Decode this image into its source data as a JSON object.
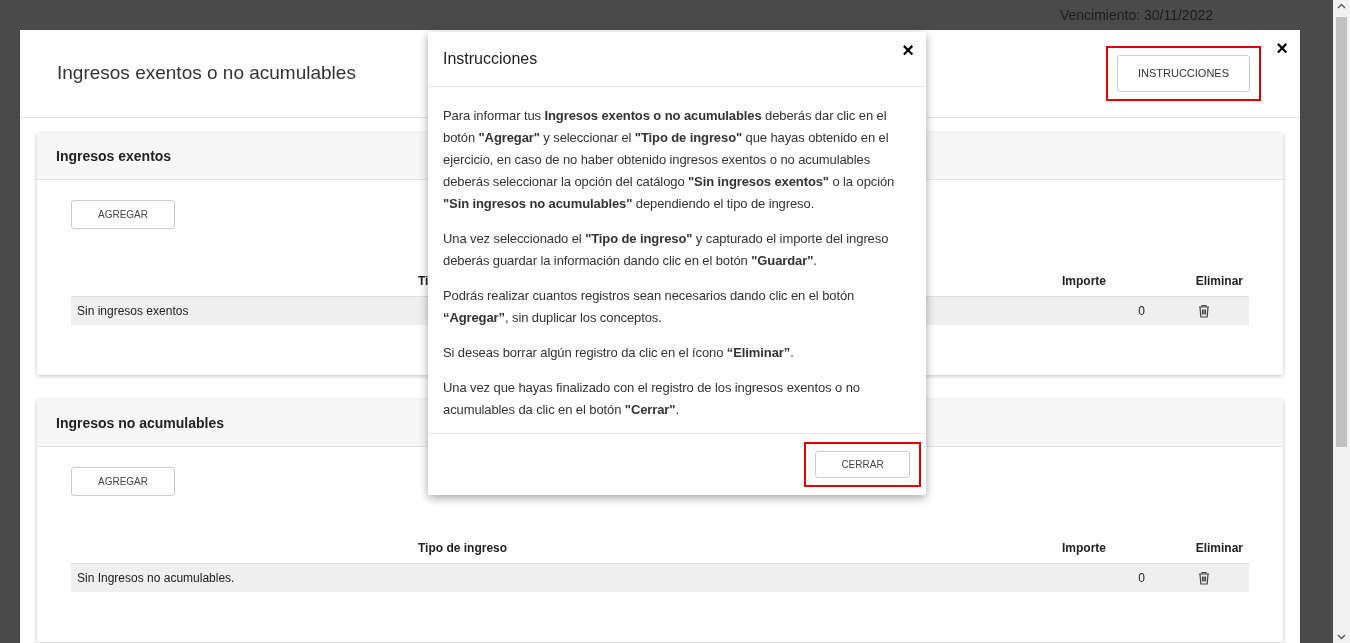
{
  "background": {
    "due_date": "Vencimiento: 30/11/2022"
  },
  "dialog": {
    "title": "Ingresos exentos o no acumulables",
    "instructions_button": {
      "label": "INSTRUCCIONES",
      "highlighted": true
    },
    "close": "×",
    "sections": [
      {
        "title": "Ingresos exentos",
        "add_button": "AGREGAR",
        "columns": [
          "Ti",
          "Importe",
          "Eliminar"
        ],
        "rows": [
          {
            "tipo": "Sin ingresos exentos",
            "importe": "0"
          }
        ]
      },
      {
        "title": "Ingresos no acumulables",
        "add_button": "AGREGAR",
        "columns": [
          "Tipo de ingreso",
          "Importe",
          "Eliminar"
        ],
        "rows": [
          {
            "tipo": "Sin Ingresos no acumulables.",
            "importe": "0"
          }
        ]
      }
    ]
  },
  "modal": {
    "title": "Instrucciones",
    "close": "×",
    "paragraphs": [
      "Para informar tus **Ingresos exentos o no acumulables** deberás dar clic en el botón **\"Agregar\"** y seleccionar el **\"Tipo de ingreso\"** que hayas obtenido en el ejercicio, en caso de no haber obtenido ingresos exentos o no acumulables deberás seleccionar la opción del catálogo **\"Sin ingresos exentos\"** o la opción **\"Sin ingresos no acumulables\"** dependiendo el tipo de ingreso.",
      "Una vez seleccionado el **\"Tipo de ingreso\"** y capturado el importe del ingreso deberás guardar la información dando clic en el botón **\"Guardar\"**.",
      "Podrás realizar cuantos registros sean necesarios dando clic en el botón **“Agregar”**, sin duplicar los conceptos.",
      "Si deseas borrar algún registro da clic en el ícono **“Eliminar”**.",
      "Una vez que hayas finalizado con el registro de los ingresos exentos o no acumulables da clic en el botón **\"Cerrar\"**."
    ],
    "close_button": {
      "label": "CERRAR",
      "highlighted": true
    }
  }
}
